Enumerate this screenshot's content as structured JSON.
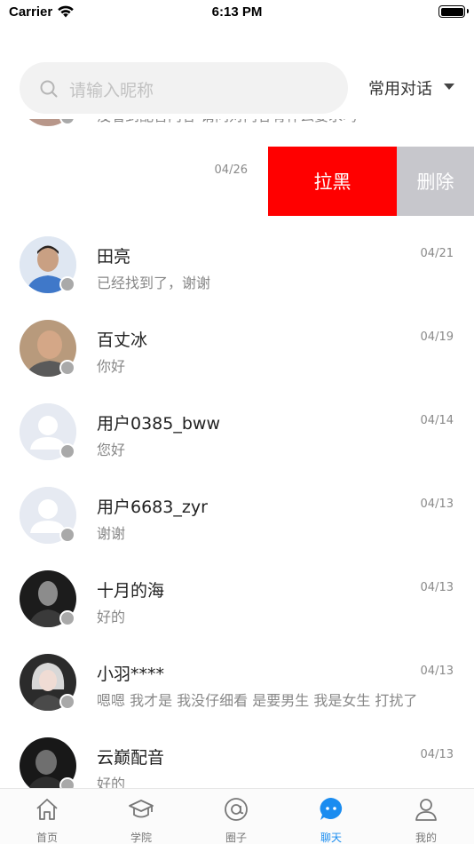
{
  "status_bar": {
    "carrier": "Carrier",
    "time": "6:13 PM"
  },
  "search": {
    "placeholder": "请输入昵称",
    "common_phrases": "常用对话"
  },
  "partial_row": {
    "message": "没看到配音内容 请问对内容有什么要求吗"
  },
  "swiped_row": {
    "date": "04/26",
    "block_label": "拉黑",
    "delete_label": "删除"
  },
  "conversations": [
    {
      "name": "田亮",
      "message": "已经找到了，谢谢",
      "date": "04/21",
      "avatar": "photo-man-blue-shirt"
    },
    {
      "name": "百丈冰",
      "message": "你好",
      "date": "04/19",
      "avatar": "photo-man-bald"
    },
    {
      "name": "用户0385_bww",
      "message": "您好",
      "date": "04/14",
      "avatar": "default-avatar"
    },
    {
      "name": "用户6683_zyr",
      "message": "谢谢",
      "date": "04/13",
      "avatar": "default-avatar"
    },
    {
      "name": "十月的海",
      "message": "好的",
      "date": "04/13",
      "avatar": "photo-man-dark"
    },
    {
      "name": "小羽****",
      "message": "嗯嗯  我才是 我没仔细看 是要男生 我是女生  打扰了",
      "date": "04/13",
      "avatar": "photo-woman-silver-hair"
    },
    {
      "name": "云巅配音",
      "message": "好的",
      "date": "04/13",
      "avatar": "photo-man-dark"
    }
  ],
  "tab_bar": {
    "tabs": [
      {
        "label": "首页",
        "icon": "home-icon"
      },
      {
        "label": "学院",
        "icon": "graduation-cap-icon"
      },
      {
        "label": "圈子",
        "icon": "at-circle-icon"
      },
      {
        "label": "聊天",
        "icon": "chat-bubble-icon",
        "active": true
      },
      {
        "label": "我的",
        "icon": "person-icon"
      }
    ]
  },
  "colors": {
    "accent": "#1a8cf0",
    "block": "#ff0000",
    "delete": "#c7c7cc",
    "status_dot": "#a9a9a9"
  }
}
